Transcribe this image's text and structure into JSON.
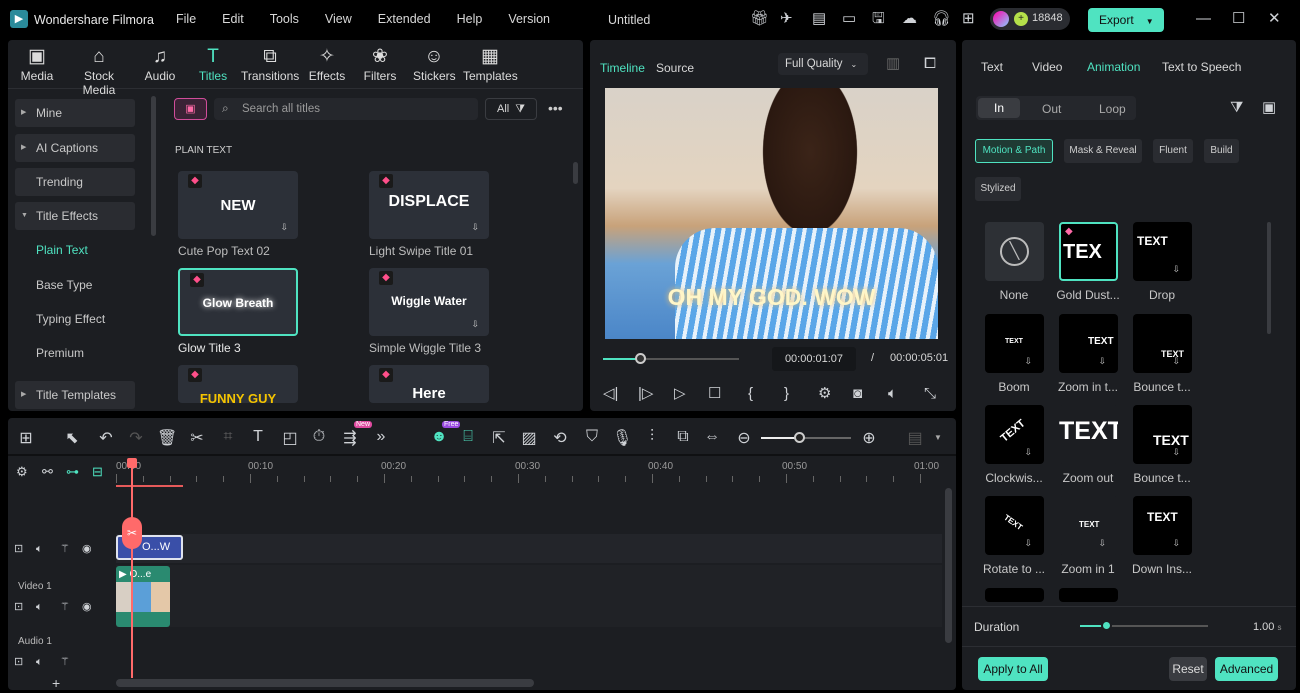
{
  "app": {
    "name": "Wondershare Filmora",
    "project_title": "Untitled",
    "credits": "18848",
    "export_label": "Export",
    "menu": [
      "File",
      "Edit",
      "Tools",
      "View",
      "Extended",
      "Help",
      "Version"
    ]
  },
  "toolbar": [
    {
      "label": "Media",
      "icon": "media-icon"
    },
    {
      "label": "Stock Media",
      "icon": "stock-media-icon"
    },
    {
      "label": "Audio",
      "icon": "audio-icon"
    },
    {
      "label": "Titles",
      "icon": "titles-icon"
    },
    {
      "label": "Transitions",
      "icon": "transitions-icon"
    },
    {
      "label": "Effects",
      "icon": "effects-icon"
    },
    {
      "label": "Filters",
      "icon": "filters-icon"
    },
    {
      "label": "Stickers",
      "icon": "stickers-icon"
    },
    {
      "label": "Templates",
      "icon": "templates-icon"
    }
  ],
  "sidebar": [
    "Mine",
    "AI Captions",
    "Trending",
    "Title Effects",
    "Plain Text",
    "Base Type",
    "Typing Effect",
    "Premium",
    "Title Templates"
  ],
  "search": {
    "placeholder": "Search all titles",
    "filter": "All"
  },
  "section_heading": "PLAIN TEXT",
  "titles": [
    {
      "thumb": "NEW",
      "label": "Cute Pop Text 02"
    },
    {
      "thumb": "DISPLACE",
      "label": "Light Swipe Title 01"
    },
    {
      "thumb": "Glow Breath",
      "label": "Glow Title 3"
    },
    {
      "thumb": "Wiggle Water",
      "label": "Simple Wiggle Title 3"
    },
    {
      "thumb": "FUNNY GUY",
      "label": ""
    },
    {
      "thumb": "Here",
      "label": ""
    }
  ],
  "preview": {
    "tabs": [
      "Timeline",
      "Source"
    ],
    "quality": "Full Quality",
    "caption": "OH MY GOD. WOW",
    "current_time": "00:00:01:07",
    "separator": "/",
    "total_time": "00:00:05:01",
    "progress": 0.22
  },
  "right": {
    "tabs": [
      "Text",
      "Video",
      "Animation",
      "Text to Speech"
    ],
    "modes": [
      "In",
      "Out",
      "Loop"
    ],
    "chips": [
      "Motion & Path",
      "Mask & Reveal",
      "Fluent",
      "Build",
      "Stylized"
    ],
    "presets": [
      {
        "label": "None",
        "thumb": ""
      },
      {
        "label": "Gold Dust...",
        "thumb": "TEX"
      },
      {
        "label": "Drop",
        "thumb": "TEXT"
      },
      {
        "label": "Boom",
        "thumb": "TEXT"
      },
      {
        "label": "Zoom in t...",
        "thumb": "TEXT"
      },
      {
        "label": "Bounce t...",
        "thumb": "TEXT"
      },
      {
        "label": "Clockwis...",
        "thumb": "TEXT"
      },
      {
        "label": "Zoom out",
        "thumb": "TEXT"
      },
      {
        "label": "Bounce t...",
        "thumb": "TEXT"
      },
      {
        "label": "Rotate to ...",
        "thumb": "TEXT"
      },
      {
        "label": "Zoom in 1",
        "thumb": "TEXT"
      },
      {
        "label": "Down Ins...",
        "thumb": "TEXT"
      }
    ],
    "duration_label": "Duration",
    "duration_value": "1.00",
    "duration_unit": "s",
    "duration_fraction": 0.2,
    "apply_all": "Apply to All",
    "reset": "Reset",
    "advanced": "Advanced"
  },
  "timeline": {
    "ruler": [
      "00:00",
      "00:10",
      "00:20",
      "00:30",
      "00:40",
      "00:50",
      "01:00"
    ],
    "tracks": [
      "Video 1",
      "Audio 1"
    ],
    "title_clip": "O...W",
    "video_clip": "O...e",
    "badge_new": "New",
    "badge_free": "Free"
  },
  "colors": {
    "accent": "#4fe3c1",
    "playhead": "#ff5a5f",
    "title_clip": "#3a4fa8",
    "video_clip": "#2a8a70"
  }
}
